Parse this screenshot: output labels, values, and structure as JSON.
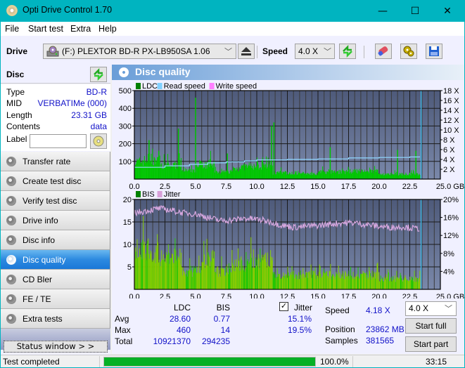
{
  "window": {
    "title": "Opti Drive Control 1.70",
    "controls": {
      "minimize": "—",
      "maximize": "☐",
      "close": "✕"
    }
  },
  "menu": [
    "File",
    "Start test",
    "Extra",
    "Help"
  ],
  "toolbar": {
    "drive_label": "Drive",
    "drive_value": "(F:)  PLEXTOR BD-R  PX-LB950SA 1.06",
    "speed_label": "Speed",
    "speed_value": "4.0 X",
    "icons": [
      "eject-icon",
      "refresh-icon",
      "erase-icon",
      "settings-icon",
      "save-icon"
    ]
  },
  "disc": {
    "title": "Disc",
    "rows": [
      {
        "key": "Type",
        "value": "BD-R"
      },
      {
        "key": "MID",
        "value": "VERBATIMe (000)"
      },
      {
        "key": "Length",
        "value": "23.31 GB"
      },
      {
        "key": "Contents",
        "value": "data"
      }
    ],
    "label_key": "Label",
    "label_value": ""
  },
  "nav": [
    {
      "label": "Transfer rate",
      "active": false
    },
    {
      "label": "Create test disc",
      "active": false
    },
    {
      "label": "Verify test disc",
      "active": false
    },
    {
      "label": "Drive info",
      "active": false
    },
    {
      "label": "Disc info",
      "active": false
    },
    {
      "label": "Disc quality",
      "active": true
    },
    {
      "label": "CD Bler",
      "active": false
    },
    {
      "label": "FE / TE",
      "active": false
    },
    {
      "label": "Extra tests",
      "active": false
    }
  ],
  "status_window_button": "Status window > >",
  "panel": {
    "title": "Disc quality"
  },
  "chart_data": [
    {
      "type": "bar",
      "title": "LDC / Read speed",
      "legend": [
        {
          "name": "LDC",
          "color": "#008000"
        },
        {
          "name": "Read speed",
          "color": "#80d0ff"
        },
        {
          "name": "Write speed",
          "color": "#ff80ff"
        }
      ],
      "x_ticks": [
        "0.0",
        "2.5",
        "5.0",
        "7.5",
        "10.0",
        "12.5",
        "15.0",
        "17.5",
        "20.0",
        "22.5",
        "25.0 GB"
      ],
      "xlim": [
        0,
        25
      ],
      "y_ticks": [
        "500",
        "400",
        "300",
        "200",
        "100"
      ],
      "ylim": [
        0,
        500
      ],
      "y2_ticks": [
        "18 X",
        "16 X",
        "14 X",
        "12 X",
        "10 X",
        "8 X",
        "6 X",
        "4 X",
        "2 X"
      ],
      "y2lim": [
        0,
        18
      ],
      "end_marker_x": 23.31,
      "ldc_profile": [
        [
          0.0,
          120
        ],
        [
          0.5,
          130
        ],
        [
          1.0,
          145
        ],
        [
          1.5,
          125
        ],
        [
          2.0,
          100
        ],
        [
          2.5,
          95
        ],
        [
          3.0,
          100
        ],
        [
          3.5,
          115
        ],
        [
          3.8,
          60
        ],
        [
          4.5,
          55
        ],
        [
          5.0,
          120
        ],
        [
          5.5,
          100
        ],
        [
          6.0,
          110
        ],
        [
          6.5,
          50
        ],
        [
          7.5,
          55
        ],
        [
          8.0,
          75
        ],
        [
          8.5,
          85
        ],
        [
          9.0,
          90
        ],
        [
          10.0,
          95
        ],
        [
          11.0,
          100
        ],
        [
          11.3,
          45
        ],
        [
          12.5,
          40
        ],
        [
          15.0,
          50
        ],
        [
          17.5,
          55
        ],
        [
          20.0,
          35
        ],
        [
          22.5,
          35
        ],
        [
          23.3,
          35
        ]
      ],
      "ldc_spikes": [
        [
          1.2,
          220
        ],
        [
          2.0,
          160
        ],
        [
          3.6,
          285
        ],
        [
          5.0,
          460
        ],
        [
          7.6,
          145
        ],
        [
          11.2,
          300
        ],
        [
          11.4,
          320
        ],
        [
          16.0,
          180
        ],
        [
          21.5,
          165
        ],
        [
          23.0,
          160
        ]
      ],
      "read_speed": [
        [
          0.0,
          2.4
        ],
        [
          2.5,
          2.7
        ],
        [
          4.5,
          3.0
        ],
        [
          6.0,
          3.3
        ],
        [
          7.5,
          3.5
        ],
        [
          9.0,
          3.7
        ],
        [
          10.0,
          3.9
        ],
        [
          12.5,
          4.0
        ],
        [
          15.0,
          4.1
        ],
        [
          17.5,
          4.3
        ],
        [
          20.0,
          4.4
        ],
        [
          22.5,
          4.5
        ],
        [
          23.3,
          4.6
        ]
      ]
    },
    {
      "type": "bar",
      "title": "BIS / Jitter",
      "legend": [
        {
          "name": "BIS",
          "color": "#008000"
        },
        {
          "name": "Jitter",
          "color": "#d8a0d8"
        }
      ],
      "x_ticks": [
        "0.0",
        "2.5",
        "5.0",
        "7.5",
        "10.0",
        "12.5",
        "15.0",
        "17.5",
        "20.0",
        "22.5",
        "25.0 GB"
      ],
      "xlim": [
        0,
        25
      ],
      "y_ticks": [
        "20",
        "15",
        "10",
        "5"
      ],
      "ylim": [
        0,
        20
      ],
      "y2_ticks": [
        "20%",
        "16%",
        "12%",
        "8%",
        "4%"
      ],
      "y2lim": [
        0,
        20
      ],
      "end_marker_x": 23.31,
      "bis_profile": [
        [
          0.0,
          11
        ],
        [
          0.5,
          11
        ],
        [
          1.0,
          11
        ],
        [
          1.5,
          10
        ],
        [
          2.0,
          9
        ],
        [
          2.5,
          8
        ],
        [
          3.0,
          9
        ],
        [
          3.5,
          9
        ],
        [
          3.8,
          5
        ],
        [
          5.0,
          6
        ],
        [
          5.5,
          8
        ],
        [
          6.0,
          9
        ],
        [
          6.5,
          5
        ],
        [
          7.5,
          6
        ],
        [
          8.0,
          7
        ],
        [
          9.0,
          8
        ],
        [
          10.0,
          8
        ],
        [
          11.0,
          7
        ],
        [
          11.3,
          4
        ],
        [
          12.5,
          4
        ],
        [
          15.0,
          4
        ],
        [
          17.5,
          4
        ],
        [
          20.0,
          3
        ],
        [
          22.5,
          3
        ],
        [
          23.3,
          4
        ]
      ],
      "jitter": [
        [
          0.0,
          17.0
        ],
        [
          1.0,
          17.5
        ],
        [
          2.0,
          18.0
        ],
        [
          3.0,
          17.6
        ],
        [
          4.0,
          17.0
        ],
        [
          5.0,
          16.8
        ],
        [
          6.0,
          16.0
        ],
        [
          7.0,
          15.3
        ],
        [
          8.0,
          15.4
        ],
        [
          9.0,
          15.8
        ],
        [
          10.0,
          15.6
        ],
        [
          11.0,
          15.1
        ],
        [
          12.0,
          14.3
        ],
        [
          13.0,
          13.8
        ],
        [
          14.0,
          14.0
        ],
        [
          15.0,
          14.2
        ],
        [
          16.0,
          14.5
        ],
        [
          17.0,
          14.8
        ],
        [
          18.0,
          14.8
        ],
        [
          19.0,
          14.4
        ],
        [
          20.0,
          14.0
        ],
        [
          21.0,
          13.8
        ],
        [
          22.0,
          13.9
        ],
        [
          23.0,
          13.5
        ]
      ]
    }
  ],
  "stats": {
    "col_ldc": "LDC",
    "col_bis": "BIS",
    "jitter_label": "Jitter",
    "jitter_checked": true,
    "rows": [
      {
        "label": "Avg",
        "ldc": "28.60",
        "bis": "0.77",
        "jitter": "15.1%"
      },
      {
        "label": "Max",
        "ldc": "460",
        "bis": "14",
        "jitter": "19.5%"
      },
      {
        "label": "Total",
        "ldc": "10921370",
        "bis": "294235",
        "jitter": ""
      }
    ],
    "speed_label": "Speed",
    "speed_value": "4.18 X",
    "position_label": "Position",
    "position_value": "23862 MB",
    "samples_label": "Samples",
    "samples_value": "381565",
    "speed_select": "4.0 X",
    "start_full": "Start full",
    "start_part": "Start part"
  },
  "statusbar": {
    "text": "Test completed",
    "progress": 100.0,
    "progress_text": "100.0%",
    "time": "33:15"
  }
}
